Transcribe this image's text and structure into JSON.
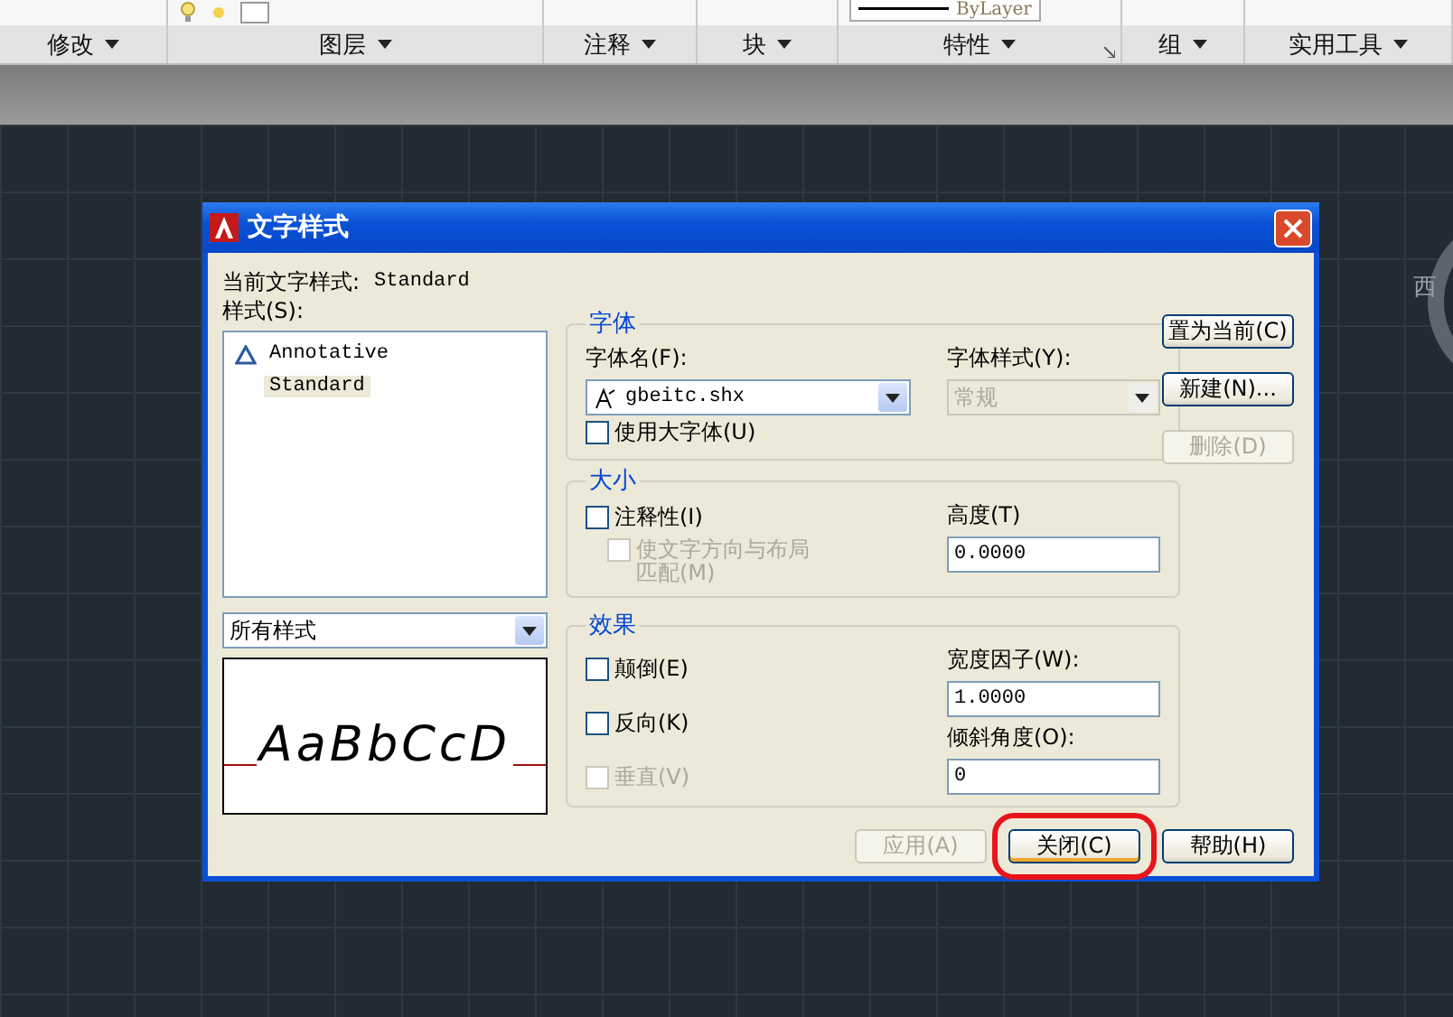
{
  "ribbon": {
    "panels": [
      {
        "label": "修改",
        "launcher": false
      },
      {
        "label": "图层",
        "launcher": false
      },
      {
        "label": "注释",
        "launcher": false
      },
      {
        "label": "块",
        "launcher": false
      },
      {
        "label": "特性",
        "launcher": true
      },
      {
        "label": "组",
        "launcher": false
      },
      {
        "label": "实用工具",
        "launcher": false
      }
    ],
    "linetype": "ByLayer"
  },
  "viewcube": {
    "label": "西"
  },
  "dialog": {
    "title": "文字样式",
    "current_style": {
      "label": "当前文字样式:",
      "value": "Standard"
    },
    "styles_label": "样式(S):",
    "styles": [
      {
        "name": "Annotative",
        "kind": "annotative",
        "selected": false
      },
      {
        "name": "Standard",
        "kind": "normal",
        "selected": true
      }
    ],
    "filter": "所有样式",
    "preview": "AaBbCcD",
    "font": {
      "title": "字体",
      "name_label": "字体名(F):",
      "name_value": "gbeitc.shx",
      "style_label": "字体样式(Y):",
      "style_value": "常规",
      "style_disabled": true,
      "big_font": {
        "label": "使用大字体(U)",
        "checked": false,
        "disabled": false
      }
    },
    "size": {
      "title": "大小",
      "annotative": {
        "label": "注释性(I)",
        "checked": false,
        "disabled": false
      },
      "match": {
        "label": "使文字方向与布局匹配(M)",
        "checked": false,
        "disabled": true
      },
      "height_label": "高度(T)",
      "height_value": "0.0000"
    },
    "effects": {
      "title": "效果",
      "checkboxes": [
        {
          "label": "颠倒(E)",
          "checked": false,
          "disabled": false
        },
        {
          "label": "反向(K)",
          "checked": false,
          "disabled": false
        },
        {
          "label": "垂直(V)",
          "checked": false,
          "disabled": true
        }
      ],
      "width_label": "宽度因子(W):",
      "width_value": "1.0000",
      "oblique_label": "倾斜角度(O):",
      "oblique_value": "0"
    },
    "side_buttons": [
      {
        "label": "置为当前(C)",
        "disabled": false
      },
      {
        "label": "新建(N)...",
        "disabled": false
      },
      {
        "label": "删除(D)",
        "disabled": true
      }
    ],
    "bottom_buttons": [
      {
        "label": "应用(A)",
        "disabled": true,
        "highlighted": false
      },
      {
        "label": "关闭(C)",
        "disabled": false,
        "highlighted": true
      },
      {
        "label": "帮助(H)",
        "disabled": false,
        "highlighted": false
      }
    ]
  }
}
